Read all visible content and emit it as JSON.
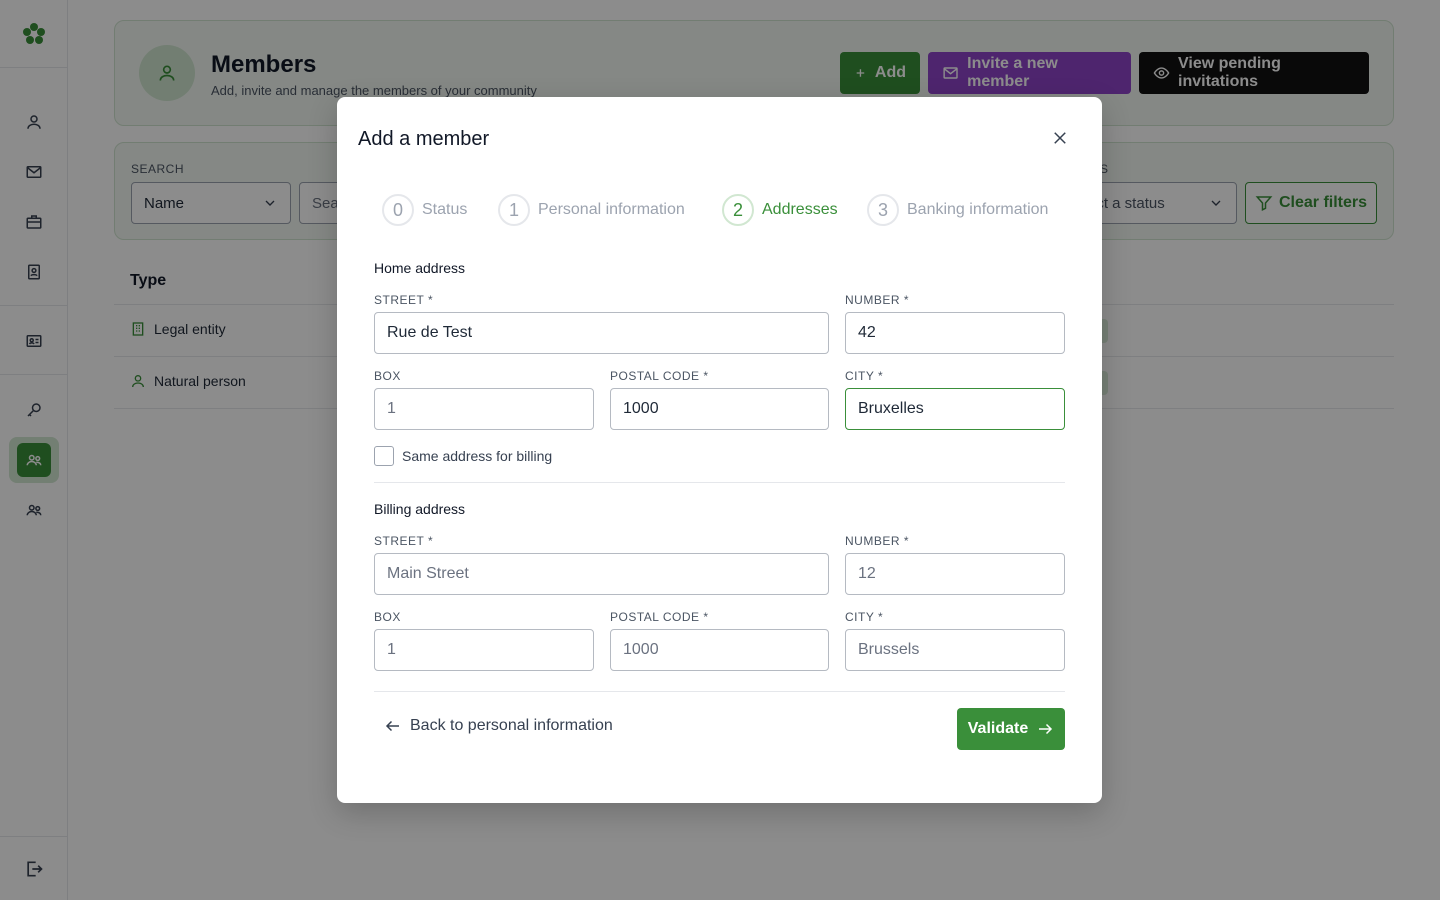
{
  "sidebar": {
    "icons": [
      "logo-icon",
      "user-icon",
      "mail-icon",
      "briefcase-icon",
      "contact-book-icon",
      "id-card-icon",
      "key-icon",
      "members-icon",
      "group-icon",
      "logout-icon"
    ]
  },
  "header": {
    "title": "Members",
    "subtitle": "Add, invite and manage the members of your community",
    "add_label": "Add",
    "invite_label": "Invite a new member",
    "view_label": "View pending invitations"
  },
  "filters": {
    "search_label": "SEARCH",
    "field_select": "Name",
    "search_placeholder": "Sea",
    "status_label": "S",
    "status_placeholder": "ect a status",
    "clear_label": "Clear filters"
  },
  "table": {
    "column_type": "Type",
    "rows": [
      {
        "type": "Legal entity"
      },
      {
        "type": "Natural person"
      }
    ]
  },
  "modal": {
    "title": "Add a member",
    "steps": [
      {
        "num": "0",
        "label": "Status"
      },
      {
        "num": "1",
        "label": "Personal information"
      },
      {
        "num": "2",
        "label": "Addresses"
      },
      {
        "num": "3",
        "label": "Banking information"
      }
    ],
    "active_step": "2",
    "home": {
      "title": "Home address",
      "street_label": "STREET *",
      "street_value": "Rue de Test",
      "number_label": "NUMBER *",
      "number_value": "42",
      "box_label": "BOX",
      "box_placeholder": "1",
      "postal_label": "POSTAL CODE *",
      "postal_value": "1000",
      "city_label": "CITY *",
      "city_value": "Bruxelles"
    },
    "same_billing_label": "Same address for billing",
    "billing": {
      "title": "Billing address",
      "street_label": "STREET *",
      "street_placeholder": "Main Street",
      "number_label": "NUMBER *",
      "number_placeholder": "12",
      "box_label": "BOX",
      "box_placeholder": "1",
      "postal_label": "POSTAL CODE *",
      "postal_placeholder": "1000",
      "city_label": "CITY *",
      "city_placeholder": "Brussels"
    },
    "back_label": "Back to personal information",
    "validate_label": "Validate"
  },
  "colors": {
    "accent": "#3a8f3a",
    "invite": "#8e44c8",
    "dark": "#111111"
  }
}
